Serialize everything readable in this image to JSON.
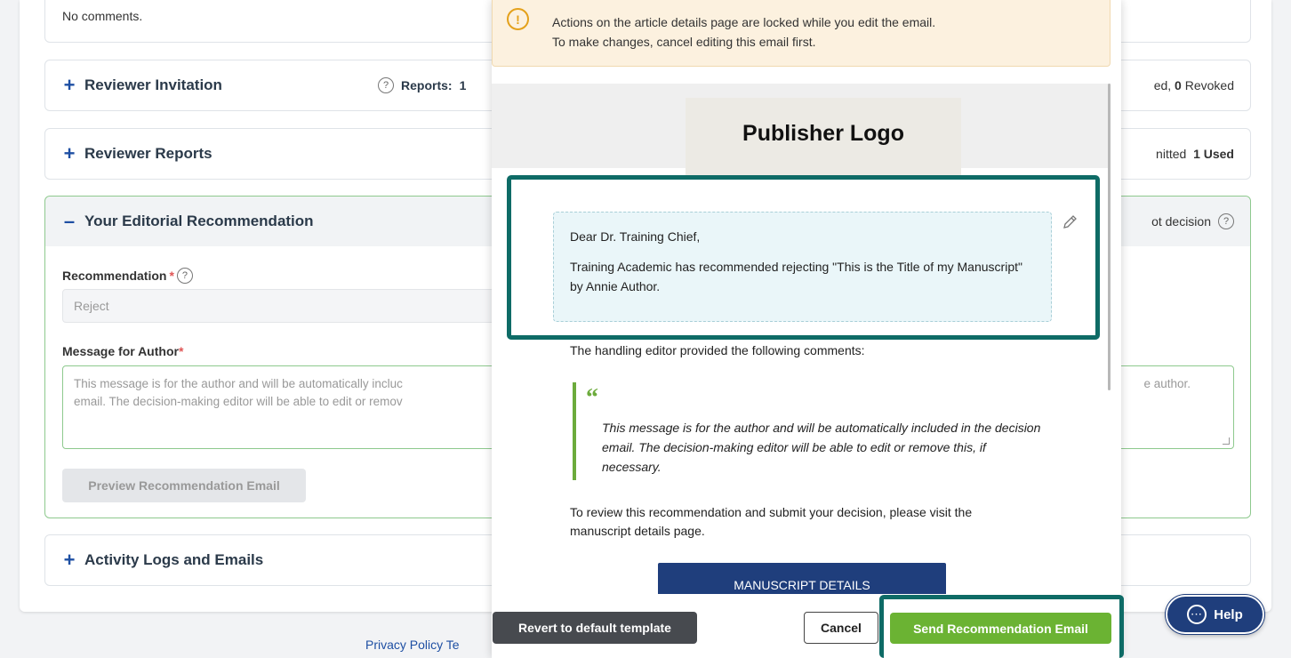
{
  "background": {
    "no_comments": "No comments.",
    "reviewer_invitation": {
      "title": "Reviewer Invitation",
      "reports_label": "Reports:",
      "reports_value": "1",
      "right_tail": "ed,",
      "revoked_count": "0",
      "revoked_label": "Revoked"
    },
    "reviewer_reports": {
      "title": "Reviewer Reports",
      "right_tail": "nitted",
      "used_label": "1 Used"
    },
    "editorial": {
      "title": "Your Editorial Recommendation",
      "right_tail": "ot decision",
      "recommendation_label": "Recommendation",
      "recommendation_value": "Reject",
      "message_label": "Message for Author",
      "message_line1": "This message is for the author and will be automatically incluc",
      "message_line2": "email. The decision-making editor will be able to edit or remov",
      "message_right": "e author.",
      "preview_button": "Preview Recommendation Email"
    },
    "activity": {
      "title": "Activity Logs and Emails"
    },
    "footer_links": "Privacy Policy  Te"
  },
  "modal": {
    "warning_line1": "Actions on the article details page are locked while you edit the email.",
    "warning_line2": "To make changes, cancel editing this email first.",
    "logo_text": "Publisher Logo",
    "greeting": "Dear Dr. Training Chief,",
    "editable_body": "Training Academic has recommended rejecting \"This is the Title of my Manuscript\" by Annie Author.",
    "handling_text": "The handling editor provided the following comments:",
    "quote_mark": "“",
    "quote_text": "This message is for the author and will be automatically included in the decision email. The decision-making editor will be able to edit or remove this, if necessary.",
    "review_text": "To review this recommendation and submit your decision, please visit the manuscript details page.",
    "manuscript_button": "MANUSCRIPT DETAILS",
    "revert_button": "Revert to default template",
    "cancel_button": "Cancel",
    "send_button": "Send Recommendation Email"
  },
  "help": {
    "label": "Help"
  },
  "colors": {
    "accent_blue": "#1f3e7c",
    "send_green": "#6bb333",
    "highlight_teal": "#0e6b66",
    "warning_bg": "#fcf1df"
  }
}
